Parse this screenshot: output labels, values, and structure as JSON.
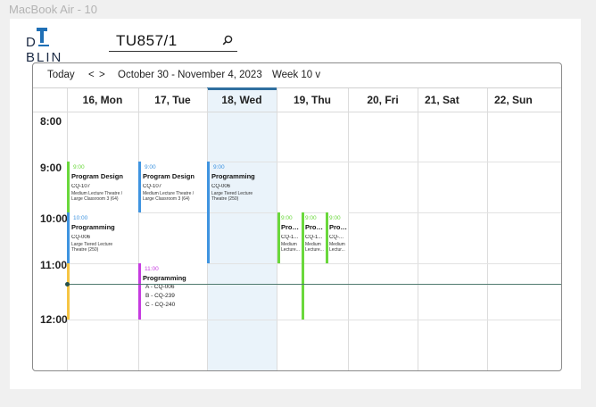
{
  "frame_label": "MacBook Air - 10",
  "logo": {
    "text_left": "D",
    "text_right": "BLIN",
    "full": "DUBLIN"
  },
  "search": {
    "value": "TU857/1",
    "icon": "search-icon"
  },
  "toolbar": {
    "today": "Today",
    "prev": "<",
    "next": ">",
    "range": "October 30 - November 4, 2023",
    "week": "Week 10 v"
  },
  "days": [
    {
      "label": "16, Mon"
    },
    {
      "label": "17, Tue"
    },
    {
      "label": "18, Wed"
    },
    {
      "label": "19, Thu"
    },
    {
      "label": "20, Fri"
    },
    {
      "label": "21, Sat"
    },
    {
      "label": "22, Sun"
    }
  ],
  "times": [
    "8:00",
    "9:00",
    "10:00",
    "11:00",
    "12:00"
  ],
  "events": {
    "mon_9": {
      "time": "9:00",
      "title": "Program Design",
      "room": "CQ-107",
      "loc1": "Medium Lecture Theatre /",
      "loc2": "Large Classroom 3 (64)",
      "color": "#6ad83c"
    },
    "mon_10": {
      "time": "10:00",
      "title": "Programming",
      "room": "CQ-006",
      "loc1": "Large Tiered Lecture",
      "loc2": "Theatre (250)",
      "color": "#3f94e0"
    },
    "tue_9": {
      "time": "9:00",
      "title": "Program Design",
      "room": "CQ-107",
      "loc1": "Medium Lecture Theatre /",
      "loc2": "Large Classroom 3 (64)",
      "color": "#3f94e0"
    },
    "tue_11": {
      "time": "11:00",
      "title": "Programming",
      "items": [
        "A - CQ-006",
        "B - CQ-239",
        "C - CQ-240"
      ],
      "color": "#c63ce0"
    },
    "wed_9": {
      "time": "9:00",
      "title": "Programming",
      "room": "CQ-006",
      "loc1": "Large Tiered Lecture",
      "loc2": "Theatre (250)",
      "color": "#3f94e0"
    },
    "thu_a": {
      "time": "9:00",
      "title": "Progr...",
      "room": "CQ-1...",
      "loc1": "Medium",
      "loc2": "Lecture...",
      "color": "#6ad83c"
    },
    "thu_b": {
      "time": "9:00",
      "title": "Progr...",
      "room": "CQ-1...",
      "loc1": "Medium",
      "loc2": "Lecture...",
      "color": "#6ad83c"
    },
    "thu_c": {
      "time": "9:00",
      "title": "Prog...",
      "room": "CQ-...",
      "loc1": "Medium",
      "loc2": "Lectur...",
      "color": "#6ad83c"
    }
  },
  "colors": {
    "accent": "#2f6f9f",
    "today_bg": "#eaf3fa",
    "now_line": "#4f7a6e",
    "logo_blue": "#1f6fb5"
  }
}
